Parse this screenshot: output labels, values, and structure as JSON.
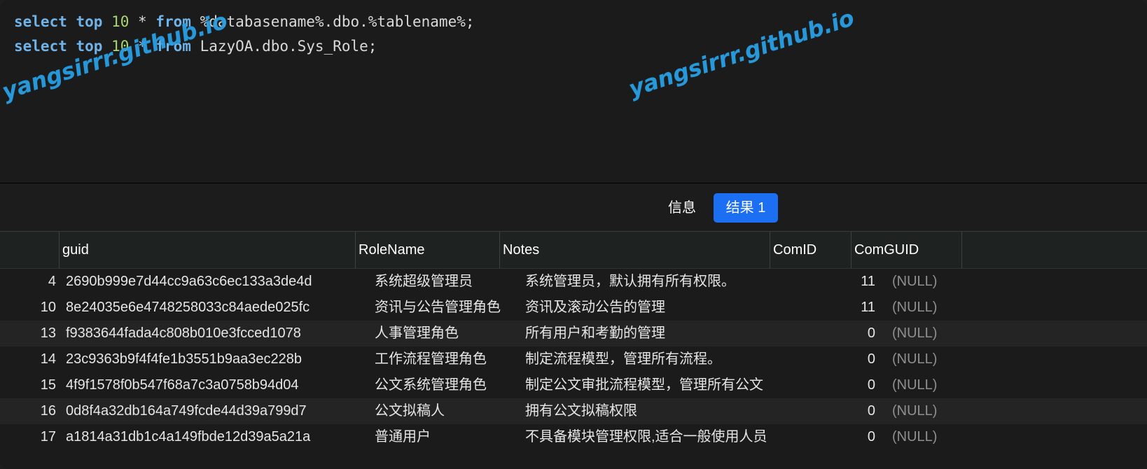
{
  "editor": {
    "lines": [
      {
        "kw1": "select",
        "kw2": "top",
        "num": "10",
        "rest1": " * ",
        "kw3": "from",
        "rest2": " %databasename%.dbo.%tablename%;"
      },
      {
        "kw1": "select",
        "kw2": "top",
        "num": "10",
        "rest1": " * ",
        "kw3": "from",
        "rest2": " LazyOA.dbo.Sys_Role;"
      }
    ],
    "watermark": "yangsirrr.github.io"
  },
  "tabs": {
    "info_label": "信息",
    "result_label": "结果 1"
  },
  "colors": {
    "accent": "#1c6ef2",
    "keyword": "#6fb3e8",
    "number": "#a8d672",
    "watermark": "#2a9fe3",
    "null": "#8f8f8f"
  },
  "table": {
    "columns": [
      "guid",
      "RoleName",
      "Notes",
      "ComID",
      "ComGUID"
    ],
    "rows": [
      {
        "idx": "4",
        "guid": "2690b999e7d44cc9a63c6ec133a3de4d",
        "role": "系统超级管理员",
        "notes": "系统管理员，默认拥有所有权限。",
        "comid": "11",
        "comguid": "(NULL)"
      },
      {
        "idx": "10",
        "guid": "8e24035e6e4748258033c84aede025fc",
        "role": "资讯与公告管理角色",
        "notes": "资讯及滚动公告的管理",
        "comid": "11",
        "comguid": "(NULL)"
      },
      {
        "idx": "13",
        "guid": "f9383644fada4c808b010e3fcced1078",
        "role": "人事管理角色",
        "notes": "所有用户和考勤的管理",
        "comid": "0",
        "comguid": "(NULL)"
      },
      {
        "idx": "14",
        "guid": "23c9363b9f4f4fe1b3551b9aa3ec228b",
        "role": "工作流程管理角色",
        "notes": "制定流程模型，管理所有流程。",
        "comid": "0",
        "comguid": "(NULL)"
      },
      {
        "idx": "15",
        "guid": "4f9f1578f0b547f68a7c3a0758b94d04",
        "role": "公文系统管理角色",
        "notes": "制定公文审批流程模型，管理所有公文",
        "comid": "0",
        "comguid": "(NULL)"
      },
      {
        "idx": "16",
        "guid": "0d8f4a32db164a749fcde44d39a799d7",
        "role": "公文拟稿人",
        "notes": "拥有公文拟稿权限",
        "comid": "0",
        "comguid": "(NULL)"
      },
      {
        "idx": "17",
        "guid": "a1814a31db1c4a149fbde12d39a5a21a",
        "role": "普通用户",
        "notes": "不具备模块管理权限,适合一般使用人员",
        "comid": "0",
        "comguid": "(NULL)"
      }
    ]
  }
}
